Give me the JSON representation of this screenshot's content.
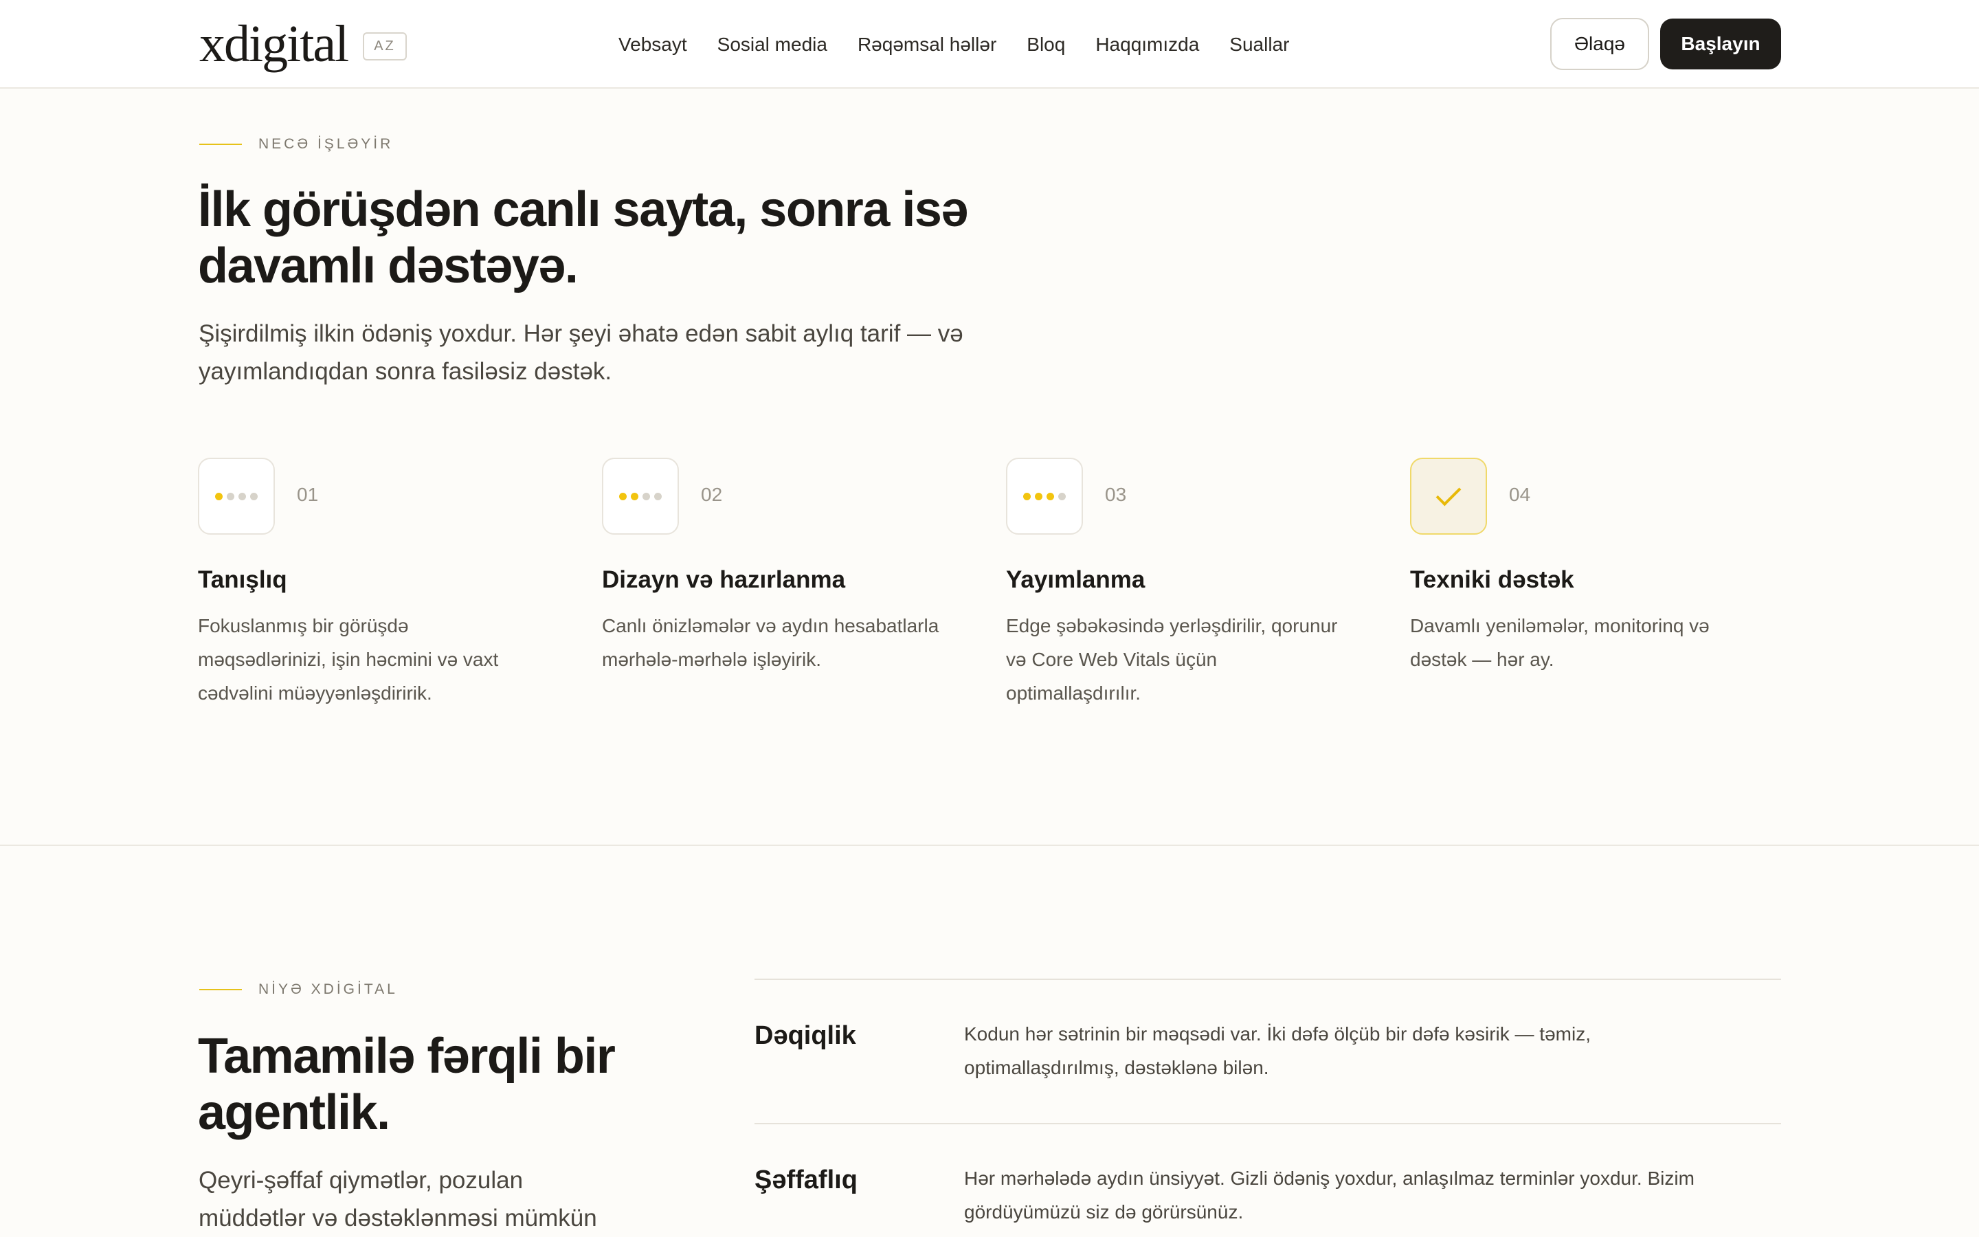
{
  "header": {
    "logo_text": "xdigital",
    "lang": "AZ",
    "nav": [
      "Vebsayt",
      "Sosial media",
      "Rəqəmsal həllər",
      "Bloq",
      "Haqqımızda",
      "Suallar"
    ],
    "contact_label": "Əlaqə",
    "start_label": "Başlayın"
  },
  "how": {
    "eyebrow": "NECƏ İŞLƏYİR",
    "title_line1": "İlk görüşdən canlı sayta, sonra isə",
    "title_line2": "davamlı dəstəyə.",
    "lead_line1": "Şişirdilmiş ilkin ödəniş yoxdur. Hər şeyi əhatə edən sabit aylıq tarif — və",
    "lead_line2": "yayımlandıqdan sonra fasiləsiz dəstək.",
    "steps": [
      {
        "num": "01",
        "title": "Tanışlıq",
        "desc_lines": [
          "Fokuslanmış bir görüşdə",
          "məqsədlərinizi, işin həcmini və vaxt",
          "cədvəlini müəyyənləşdiririk."
        ]
      },
      {
        "num": "02",
        "title": "Dizayn və hazırlanma",
        "desc_lines": [
          "Canlı önizləmələr və aydın hesabatlarla",
          "mərhələ-mərhələ işləyirik."
        ]
      },
      {
        "num": "03",
        "title": "Yayımlanma",
        "desc_lines": [
          "Edge şəbəkəsində yerləşdirilir, qorunur",
          "və Core Web Vitals üçün",
          "optimallaşdırılır."
        ]
      },
      {
        "num": "04",
        "title": "Texniki dəstək",
        "desc_lines": [
          "Davamlı yeniləmələr, monitorinq və",
          "dəstək — hər ay."
        ]
      }
    ]
  },
  "why": {
    "eyebrow": "NİYƏ XDİGİTAL",
    "title_line1": "Tamamilə fərqli bir",
    "title_line2": "agentlik.",
    "lead_line1": "Qeyri-şəffaf qiymətlər, pozulan",
    "lead_line2": "müddətlər və dəstəklənməsi mümkün",
    "items": [
      {
        "title": "Dəqiqlik",
        "desc_lines": [
          "Kodun hər sətrinin bir məqsədi var. İki dəfə ölçüb bir dəfə kəsirik — təmiz,",
          "optimallaşdırılmış, dəstəklənə bilən."
        ]
      },
      {
        "title": "Şəffaflıq",
        "desc_lines": [
          "Hər mərhələdə aydın ünsiyyət. Gizli ödəniş yoxdur, anlaşılmaz terminlər yoxdur. Bizim",
          "gördüyümüzü siz də görürsünüz."
        ]
      }
    ]
  },
  "colors": {
    "accent": "#f2c40f",
    "background": "#fdfcf9",
    "dark": "#1f1d1a"
  },
  "icons": {
    "step_progress": "progress-dots-icon",
    "step_done": "check-icon"
  }
}
